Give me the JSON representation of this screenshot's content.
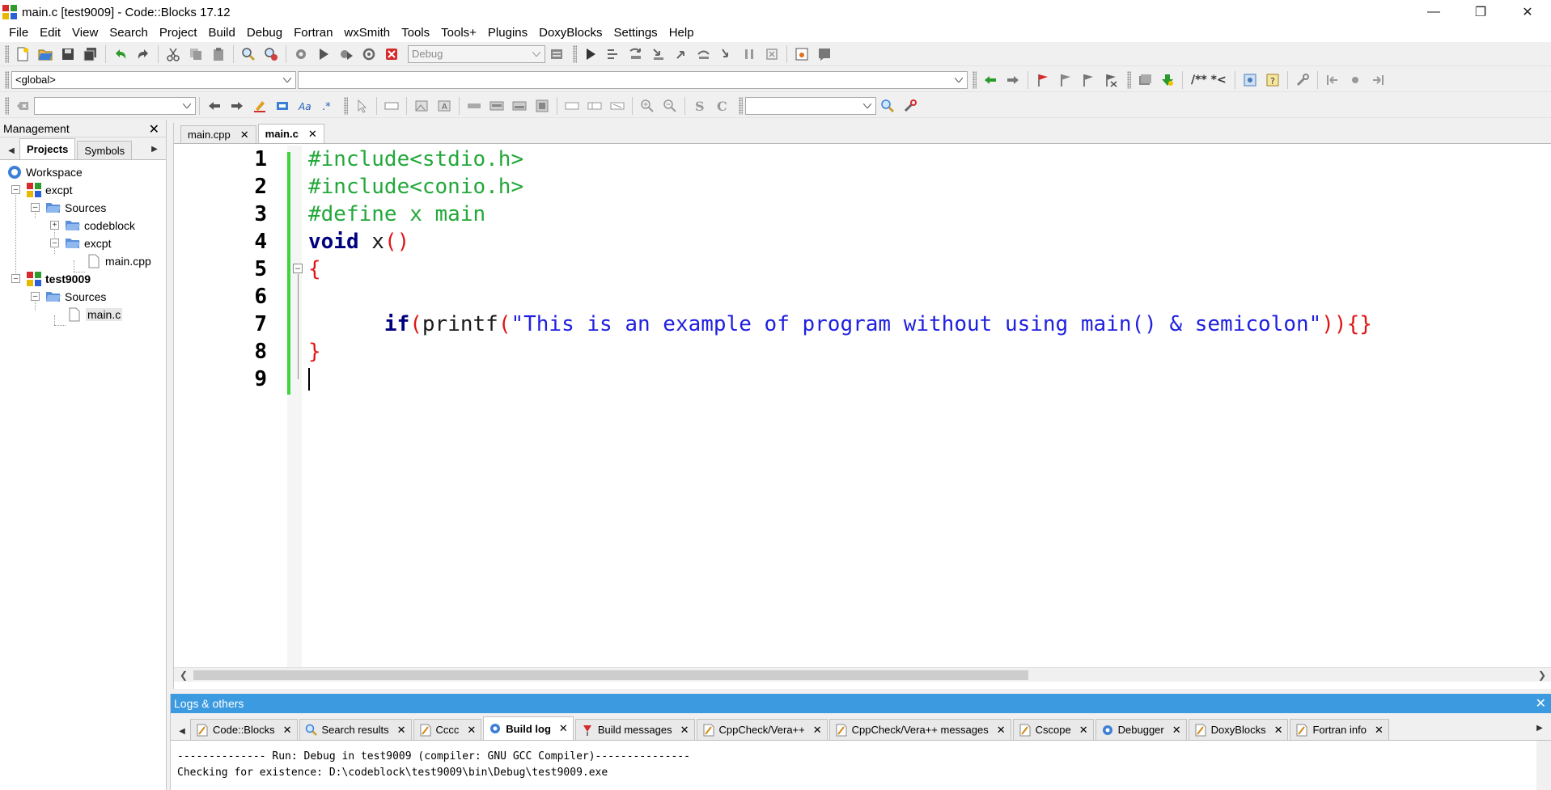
{
  "window": {
    "title": "main.c [test9009] - Code::Blocks 17.12"
  },
  "menu": [
    "File",
    "Edit",
    "View",
    "Search",
    "Project",
    "Build",
    "Debug",
    "Fortran",
    "wxSmith",
    "Tools",
    "Tools+",
    "Plugins",
    "DoxyBlocks",
    "Settings",
    "Help"
  ],
  "toolbar": {
    "build_target": "Debug",
    "scope": "<global>",
    "doxy_comment": "/** *<"
  },
  "management": {
    "title": "Management",
    "tabs": [
      "Projects",
      "Symbols"
    ],
    "tree": {
      "workspace": "Workspace",
      "p1": "excpt",
      "p1_sources": "Sources",
      "p1_folder1": "codeblock",
      "p1_folder2": "excpt",
      "p1_file": "main.cpp",
      "p2": "test9009",
      "p2_sources": "Sources",
      "p2_file": "main.c"
    }
  },
  "editor": {
    "tabs": [
      "main.cpp",
      "main.c"
    ],
    "active_tab": "main.c",
    "line_numbers": [
      "1",
      "2",
      "3",
      "4",
      "5",
      "6",
      "7",
      "8",
      "9"
    ],
    "code": {
      "l1": "#include<stdio.h>",
      "l2": "#include<conio.h>",
      "l3": "#define x main",
      "l4_kw": "void",
      "l4_name": " x",
      "l4_paren": "()",
      "l5": "{",
      "l7_indent": "      ",
      "l7_kw": "if",
      "l7_p1": "(",
      "l7_fn": "printf",
      "l7_p2": "(",
      "l7_str": "\"This is an example of program without using main() & semicolon\"",
      "l7_tail": ")){}",
      "l8": "}"
    }
  },
  "logs": {
    "title": "Logs & others",
    "tabs": [
      "Code::Blocks",
      "Search results",
      "Cccc",
      "Build log",
      "Build messages",
      "CppCheck/Vera++",
      "CppCheck/Vera++ messages",
      "Cscope",
      "Debugger",
      "DoxyBlocks",
      "Fortran info"
    ],
    "active_tab": "Build log",
    "lines": [
      "-------------- Run: Debug in test9009 (compiler: GNU GCC Compiler)---------------",
      "Checking for existence: D:\\codeblock\\test9009\\bin\\Debug\\test9009.exe"
    ]
  },
  "colors": {
    "preprocessor": "#23a83a",
    "keyword": "#00007f",
    "string": "#2020e0",
    "brace": "#e01515",
    "change_bar": "#3bd63b",
    "logs_header": "#3c9be0"
  }
}
